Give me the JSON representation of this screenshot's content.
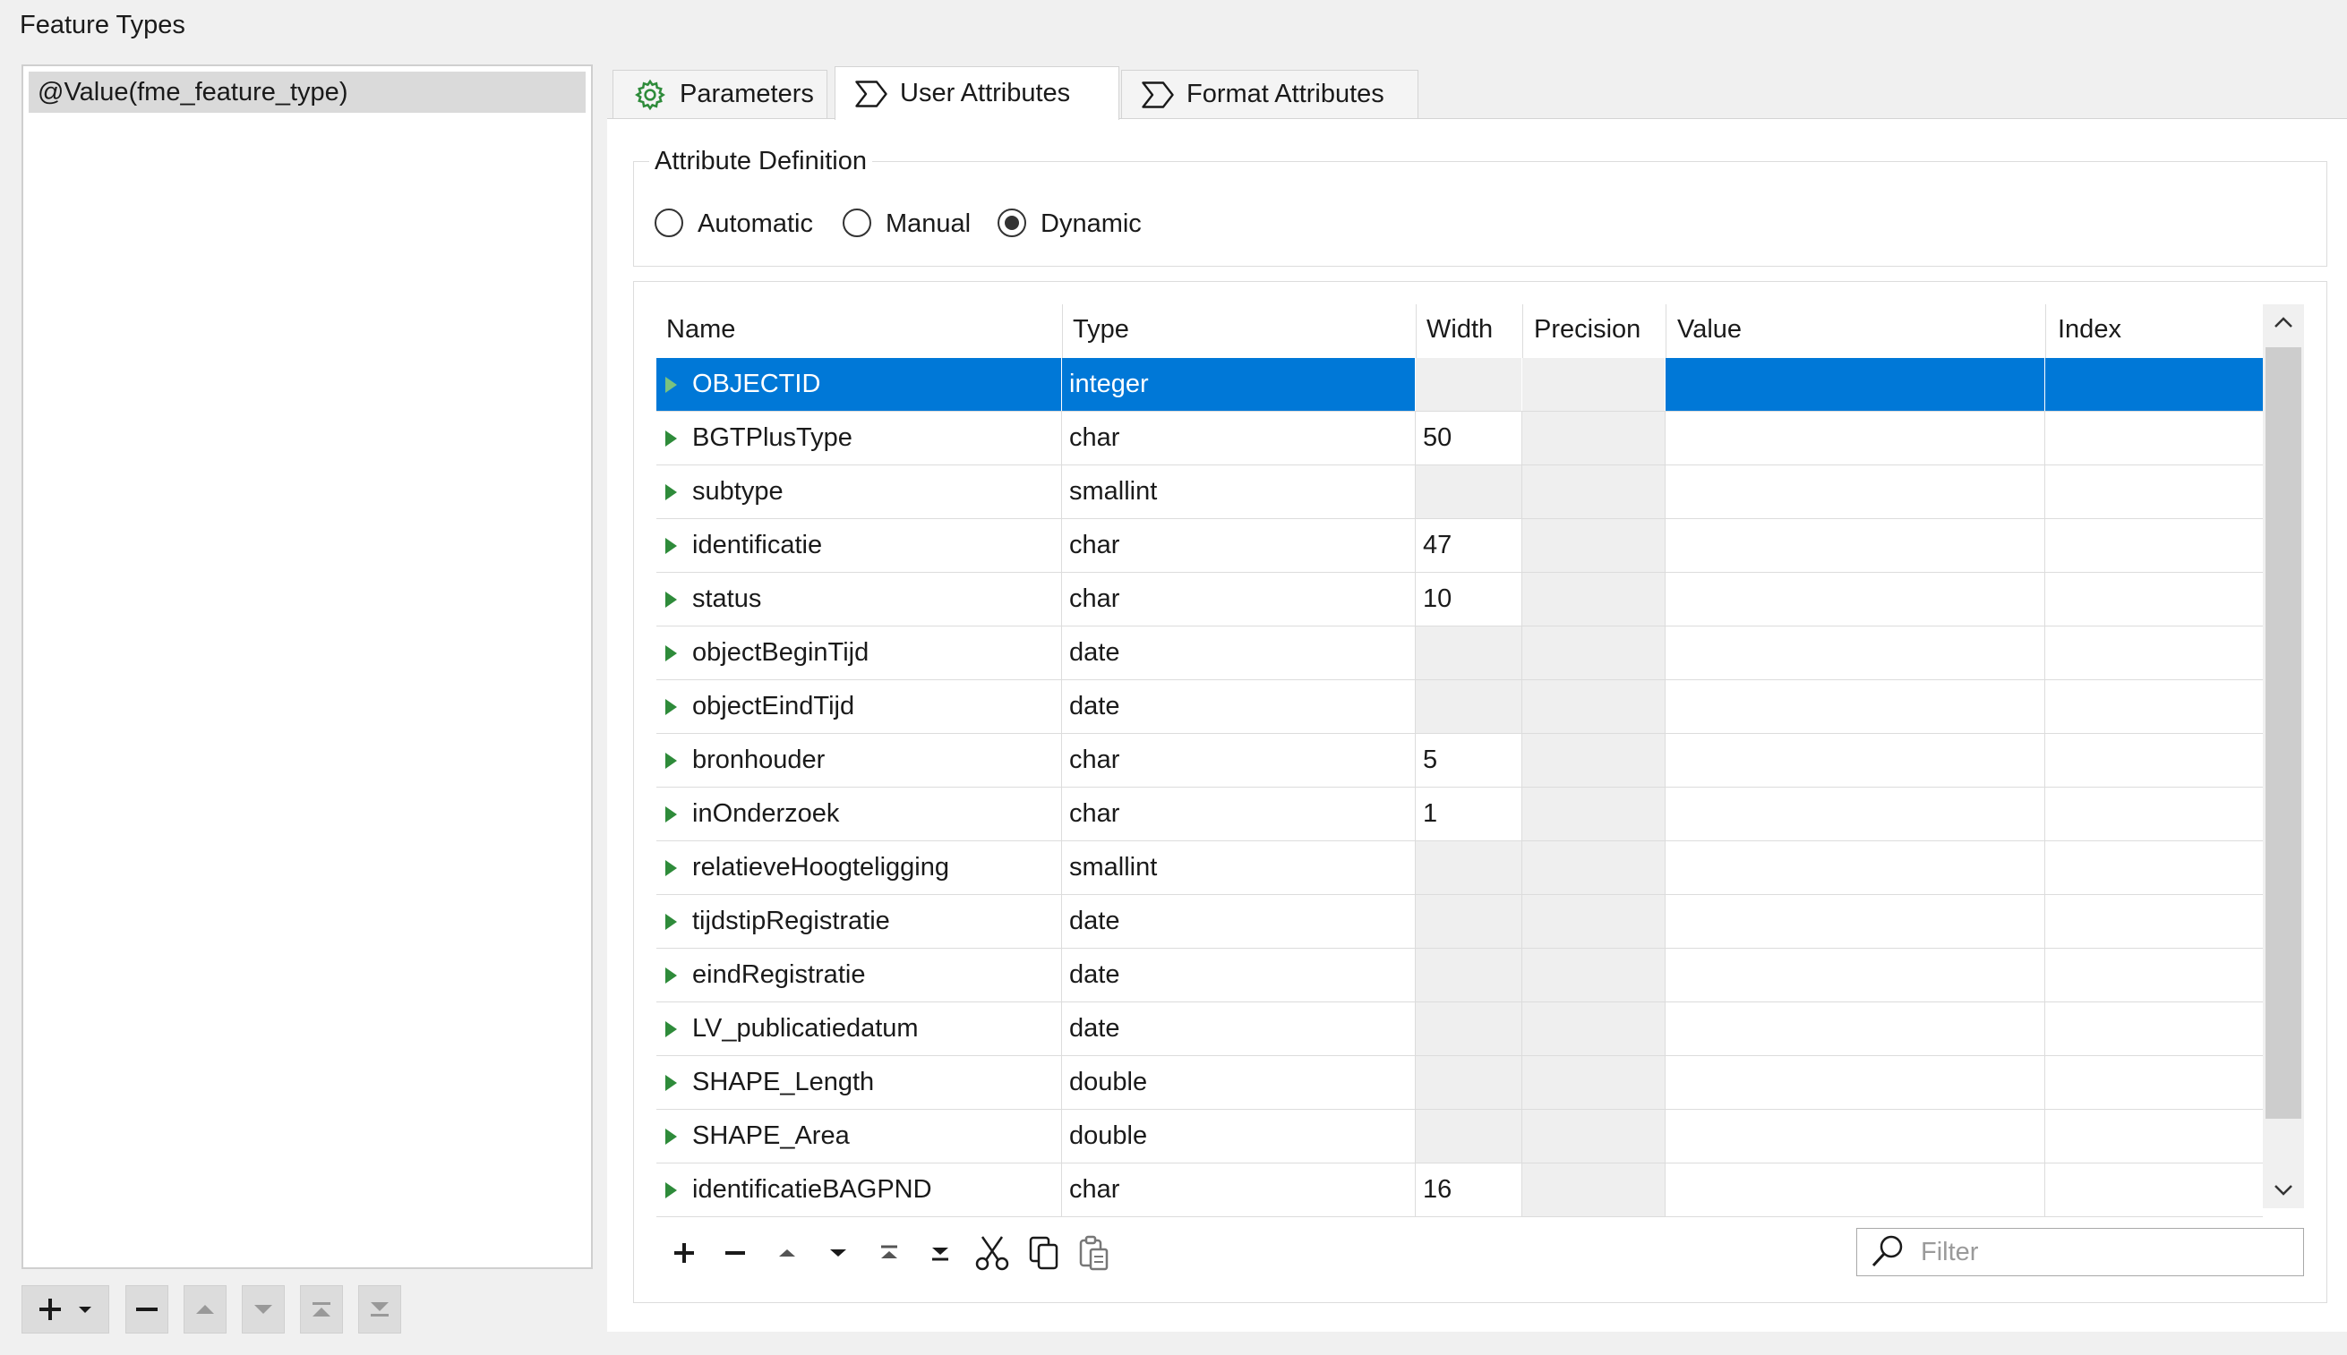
{
  "panel_title": "Feature Types",
  "feature_types": [
    {
      "label": "@Value(fme_feature_type)"
    }
  ],
  "tabs": [
    {
      "label": "Parameters",
      "icon": "gear-icon"
    },
    {
      "label": "User Attributes",
      "icon": "attribute-icon"
    },
    {
      "label": "Format Attributes",
      "icon": "attribute-icon"
    }
  ],
  "active_tab": "User Attributes",
  "attribute_definition": {
    "title": "Attribute Definition",
    "options": [
      "Automatic",
      "Manual",
      "Dynamic"
    ],
    "selected": "Dynamic"
  },
  "table": {
    "columns": [
      "Name",
      "Type",
      "Width",
      "Precision",
      "Value",
      "Index"
    ],
    "rows": [
      {
        "name": "OBJECTID",
        "type": "integer",
        "width": "",
        "selected": true
      },
      {
        "name": "BGTPlusType",
        "type": "char",
        "width": "50"
      },
      {
        "name": "subtype",
        "type": "smallint",
        "width": ""
      },
      {
        "name": "identificatie",
        "type": "char",
        "width": "47"
      },
      {
        "name": "status",
        "type": "char",
        "width": "10"
      },
      {
        "name": "objectBeginTijd",
        "type": "date",
        "width": ""
      },
      {
        "name": "objectEindTijd",
        "type": "date",
        "width": ""
      },
      {
        "name": "bronhouder",
        "type": "char",
        "width": "5"
      },
      {
        "name": "inOnderzoek",
        "type": "char",
        "width": "1"
      },
      {
        "name": "relatieveHoogteligging",
        "type": "smallint",
        "width": ""
      },
      {
        "name": "tijdstipRegistratie",
        "type": "date",
        "width": ""
      },
      {
        "name": "eindRegistratie",
        "type": "date",
        "width": ""
      },
      {
        "name": "LV_publicatiedatum",
        "type": "date",
        "width": ""
      },
      {
        "name": "SHAPE_Length",
        "type": "double",
        "width": ""
      },
      {
        "name": "SHAPE_Area",
        "type": "double",
        "width": ""
      },
      {
        "name": "identificatieBAGPND",
        "type": "char",
        "width": "16"
      }
    ]
  },
  "filter": {
    "placeholder": "Filter"
  },
  "colors": {
    "selection": "#0078d7",
    "row_arrow": "#2e8b3a"
  }
}
